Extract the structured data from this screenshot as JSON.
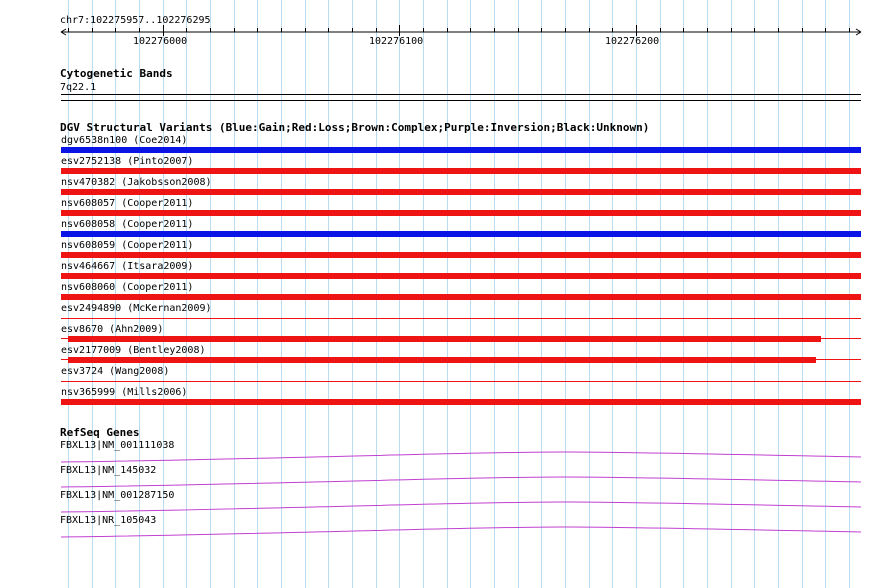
{
  "ruler": {
    "range_label": "chr7:102275957..102276295",
    "ticks": [
      "102276000",
      "102276100",
      "102276200"
    ]
  },
  "cytoband": {
    "title": "Cytogenetic Bands",
    "band": "7q22.1"
  },
  "dgv": {
    "title": "DGV Structural Variants (Blue:Gain;Red:Loss;Brown:Complex;Purple:Inversion;Black:Unknown)",
    "colors": {
      "gain": "#0a14e6",
      "loss": "#ef1414"
    },
    "variants": [
      {
        "label": "dgv6538n100 (Coe2014)",
        "type": "gain",
        "start": 102275957,
        "end": 102276295,
        "full": true
      },
      {
        "label": "esv2752138 (Pinto2007)",
        "type": "loss",
        "start": 102275957,
        "end": 102276295,
        "full": true
      },
      {
        "label": "nsv470382 (Jakobsson2008)",
        "type": "loss",
        "start": 102275957,
        "end": 102276295,
        "full": true
      },
      {
        "label": "nsv608057 (Cooper2011)",
        "type": "loss",
        "start": 102275957,
        "end": 102276295,
        "full": true
      },
      {
        "label": "nsv608058 (Cooper2011)",
        "type": "gain",
        "start": 102275957,
        "end": 102276295,
        "full": true
      },
      {
        "label": "nsv608059 (Cooper2011)",
        "type": "loss",
        "start": 102275957,
        "end": 102276295,
        "full": true
      },
      {
        "label": "nsv464667 (Itsara2009)",
        "type": "loss",
        "start": 102275957,
        "end": 102276295,
        "full": true
      },
      {
        "label": "nsv608060 (Cooper2011)",
        "type": "loss",
        "start": 102275957,
        "end": 102276295,
        "full": true
      },
      {
        "label": "esv2494890 (McKernan2009)",
        "type": "loss",
        "start": 102275957,
        "end": 102276295,
        "full": false
      },
      {
        "label": "esv8670 (Ahn2009)",
        "type": "loss",
        "start": 102275960,
        "end": 102276278,
        "full": true
      },
      {
        "label": "esv2177009 (Bentley2008)",
        "type": "loss",
        "start": 102275960,
        "end": 102276276,
        "full": true
      },
      {
        "label": "esv3724 (Wang2008)",
        "type": "loss",
        "start": 102275957,
        "end": 102276295,
        "full": false
      },
      {
        "label": "nsv365999 (Mills2006)",
        "type": "loss",
        "start": 102275957,
        "end": 102276295,
        "full": true
      }
    ]
  },
  "refseq": {
    "title": "RefSeq Genes",
    "color": "#c040d0",
    "genes": [
      {
        "label": "FBXL13|NM_001111038"
      },
      {
        "label": "FBXL13|NM_145032"
      },
      {
        "label": "FBXL13|NM_001287150"
      },
      {
        "label": "FBXL13|NR_105043"
      }
    ]
  }
}
